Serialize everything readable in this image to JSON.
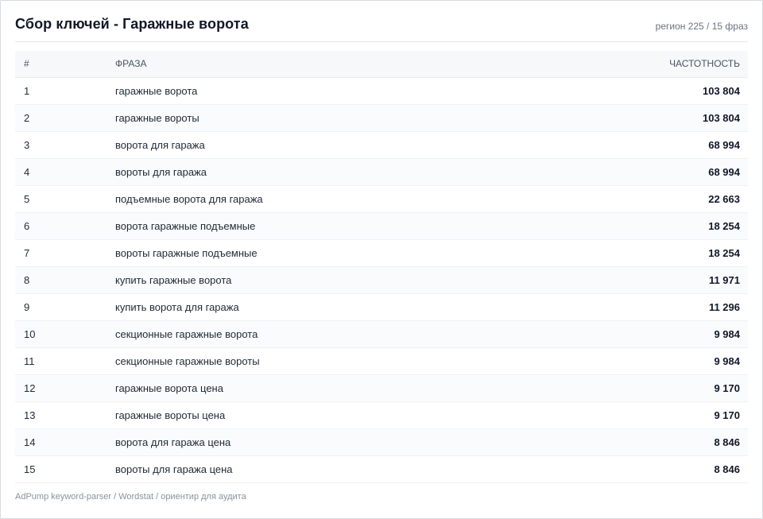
{
  "header": {
    "title": "Сбор ключей - Гаражные ворота",
    "meta": "регион 225 / 15 фраз"
  },
  "table": {
    "columns": {
      "num": "#",
      "phrase": "ФРАЗА",
      "freq": "ЧАСТОТНОСТЬ"
    },
    "rows": [
      {
        "num": "1",
        "phrase": "гаражные ворота",
        "freq": "103 804"
      },
      {
        "num": "2",
        "phrase": "гаражные вороты",
        "freq": "103 804"
      },
      {
        "num": "3",
        "phrase": "ворота для гаража",
        "freq": "68 994"
      },
      {
        "num": "4",
        "phrase": "вороты для гаража",
        "freq": "68 994"
      },
      {
        "num": "5",
        "phrase": "подъемные ворота для гаража",
        "freq": "22 663"
      },
      {
        "num": "6",
        "phrase": "ворота гаражные подъемные",
        "freq": "18 254"
      },
      {
        "num": "7",
        "phrase": "вороты гаражные подъемные",
        "freq": "18 254"
      },
      {
        "num": "8",
        "phrase": "купить гаражные ворота",
        "freq": "11 971"
      },
      {
        "num": "9",
        "phrase": "купить ворота для гаража",
        "freq": "11 296"
      },
      {
        "num": "10",
        "phrase": "секционные гаражные ворота",
        "freq": "9 984"
      },
      {
        "num": "11",
        "phrase": "секционные гаражные вороты",
        "freq": "9 984"
      },
      {
        "num": "12",
        "phrase": "гаражные ворота цена",
        "freq": "9 170"
      },
      {
        "num": "13",
        "phrase": "гаражные вороты цена",
        "freq": "9 170"
      },
      {
        "num": "14",
        "phrase": "ворота для гаража цена",
        "freq": "8 846"
      },
      {
        "num": "15",
        "phrase": "вороты для гаража цена",
        "freq": "8 846"
      }
    ]
  },
  "footer": {
    "text": "AdPump keyword-parser / Wordstat / ориентир для аудита"
  }
}
